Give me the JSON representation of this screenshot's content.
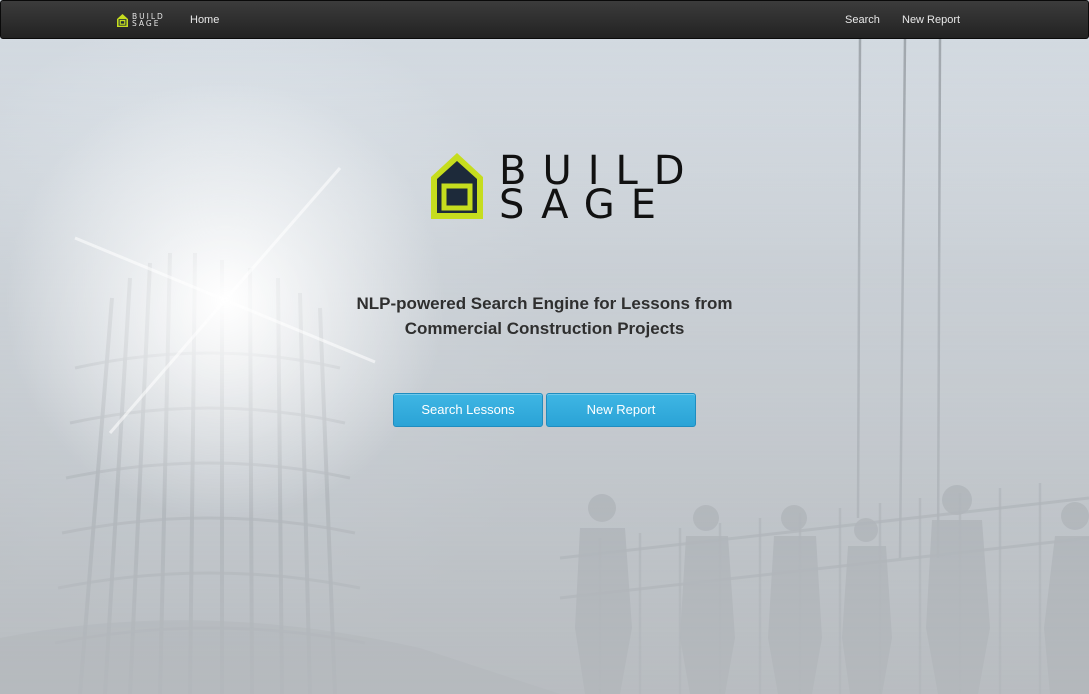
{
  "navbar": {
    "brand": {
      "line1": "BUILD",
      "line2": "SAGE",
      "icon": "house-logo-icon"
    },
    "home_label": "Home",
    "search_label": "Search",
    "new_report_label": "New Report"
  },
  "hero": {
    "logo": {
      "line1": "BUILD",
      "line2": "SAGE",
      "icon": "house-logo-icon"
    },
    "tagline": "NLP-powered Search Engine for Lessons from\nCommercial  Construction Projects",
    "buttons": {
      "search_lessons": "Search Lessons",
      "new_report": "New Report"
    },
    "background": "construction-site-silhouette-photo"
  },
  "colors": {
    "navbar": "#2b2b2b",
    "logo_green": "#c6dd1e",
    "logo_navy": "#1d2a3a",
    "button_blue": "#33abdd",
    "tagline_text": "#2f2f2f"
  }
}
